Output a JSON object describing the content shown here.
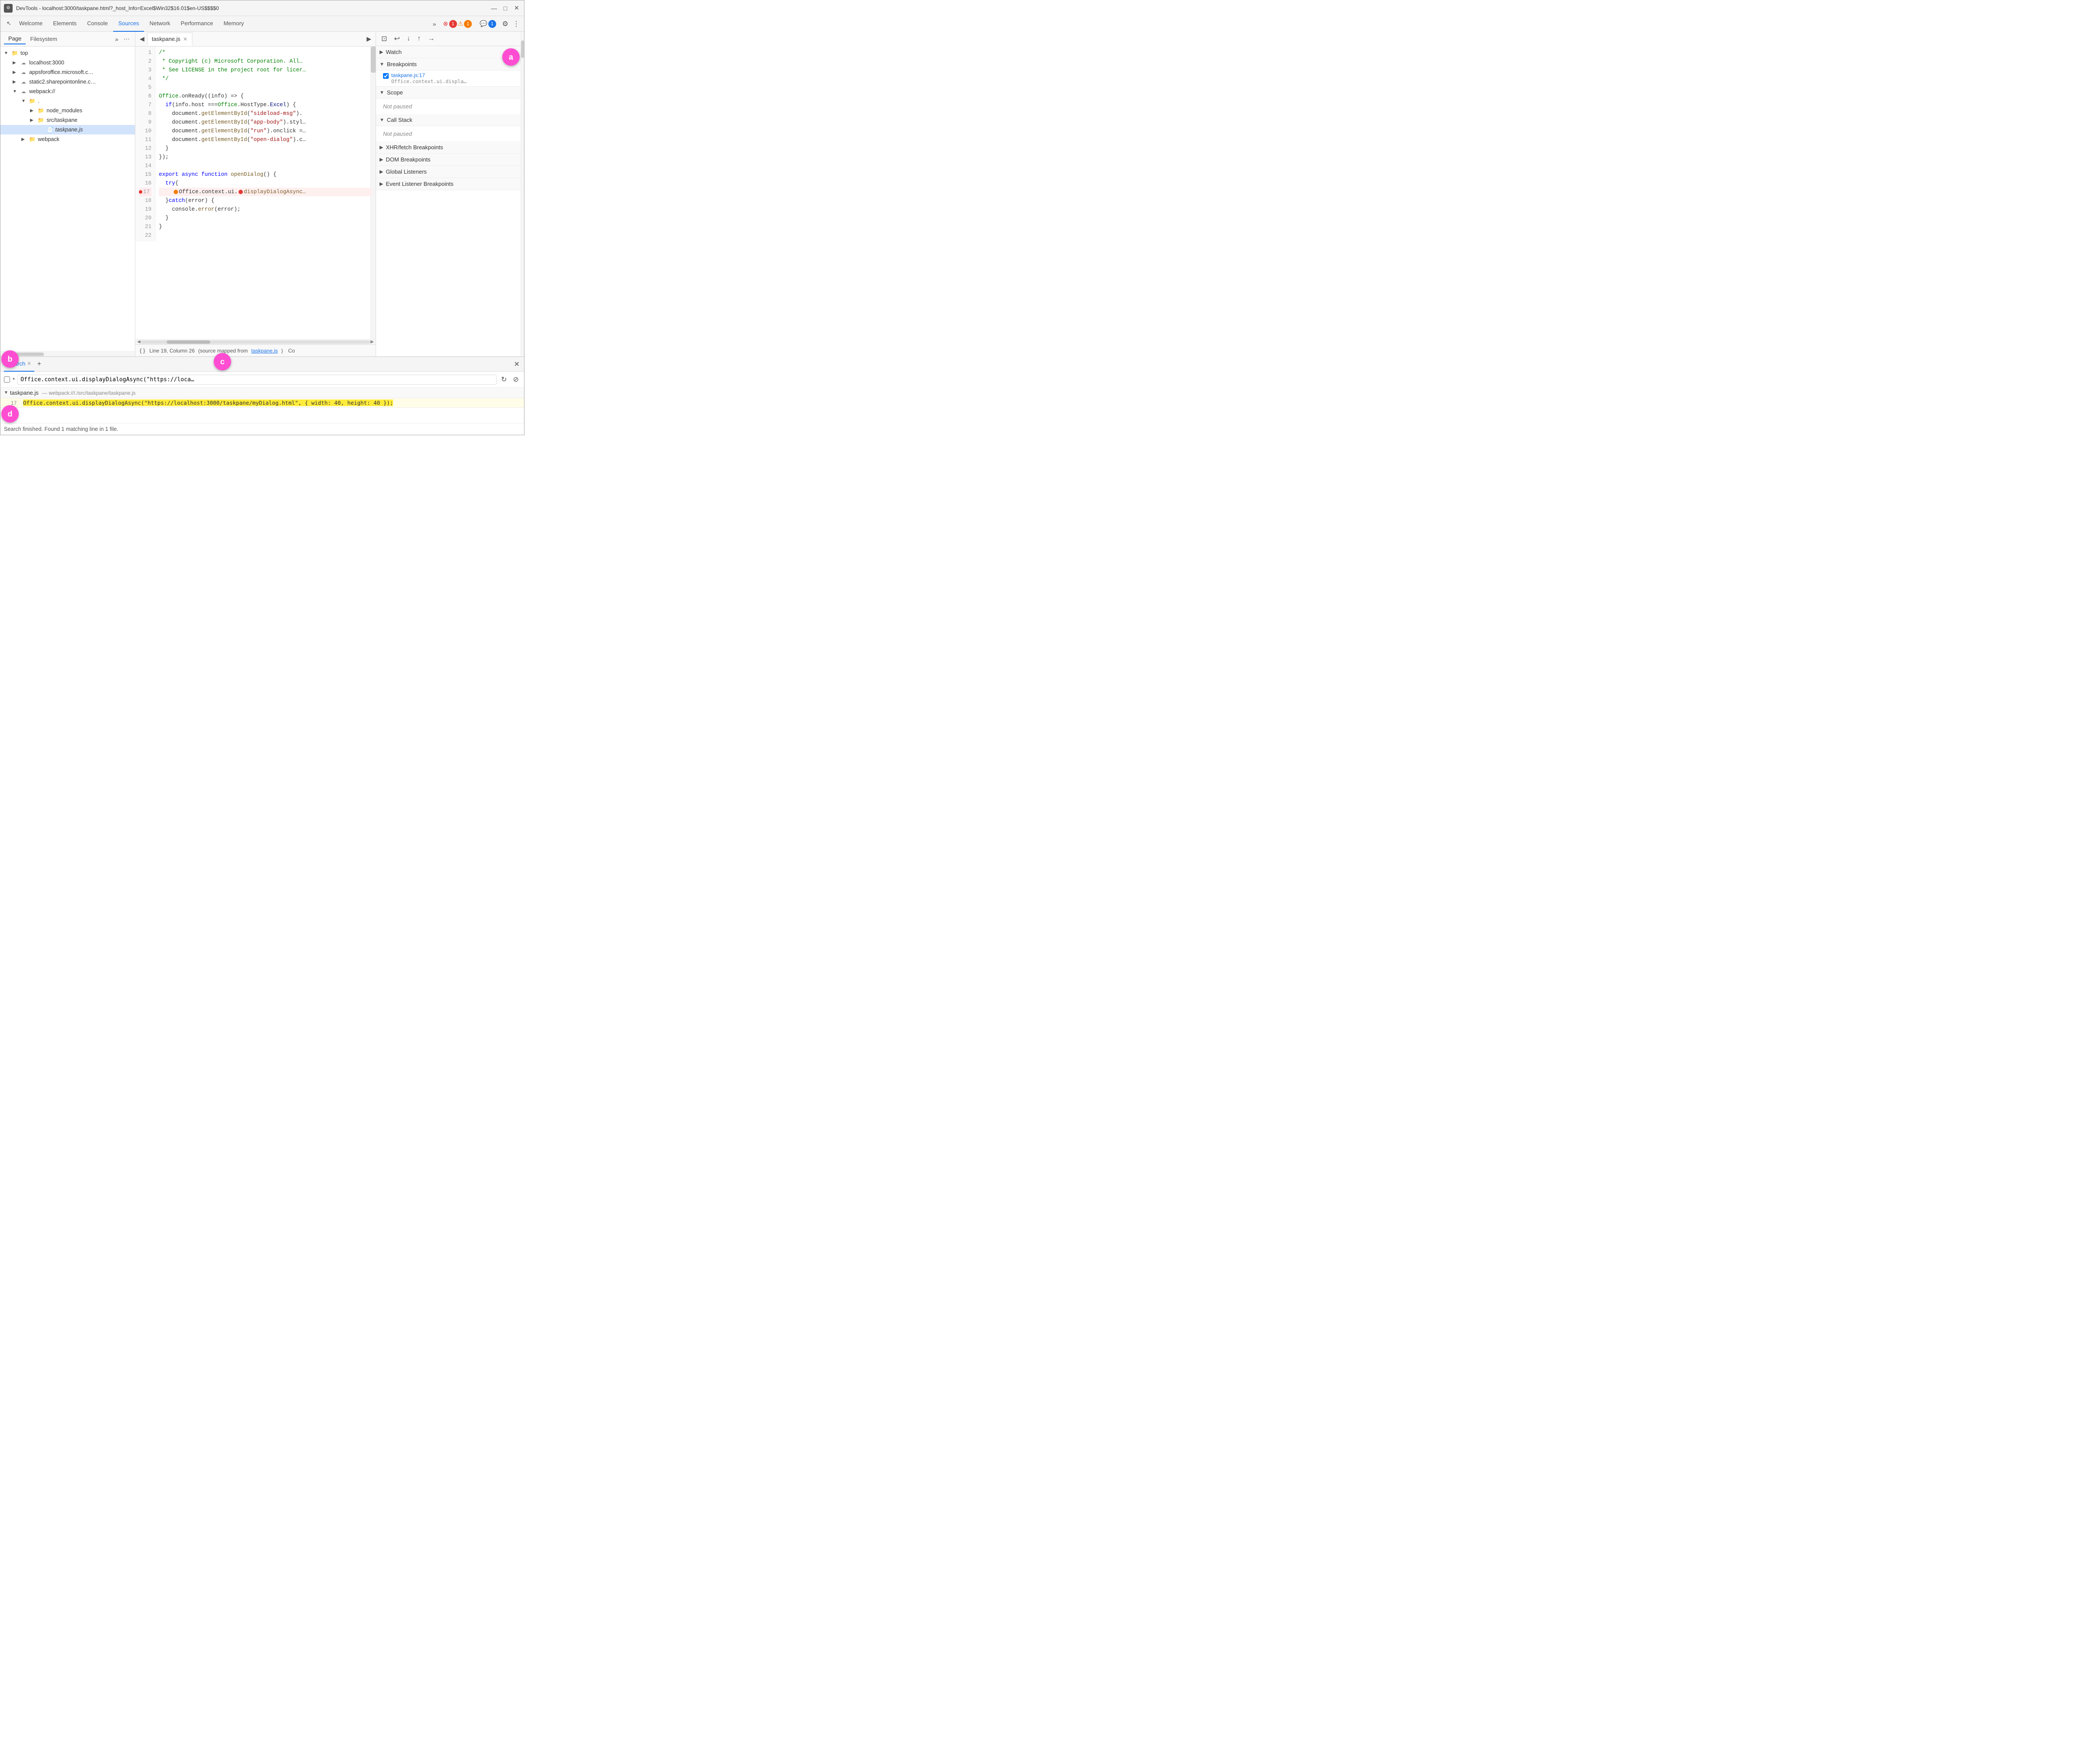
{
  "titlebar": {
    "icon": "⚙",
    "title": "DevTools - localhost:3000/taskpane.html?_host_Info=Excel$Win32$16.01$en-US$$$$0",
    "minimize": "—",
    "maximize": "□",
    "close": "✕"
  },
  "main_tabs": {
    "icon_tab": "↖",
    "tabs": [
      {
        "id": "welcome",
        "label": "Welcome",
        "active": false
      },
      {
        "id": "elements",
        "label": "Elements",
        "active": false
      },
      {
        "id": "console",
        "label": "Console",
        "active": false
      },
      {
        "id": "sources",
        "label": "Sources",
        "active": true
      },
      {
        "id": "network",
        "label": "Network",
        "active": false
      },
      {
        "id": "performance",
        "label": "Performance",
        "active": false
      },
      {
        "id": "memory",
        "label": "Memory",
        "active": false
      }
    ],
    "more_btn": "»",
    "badge_error_count": "1",
    "badge_warn_count": "1",
    "badge_info_count": "1",
    "gear_icon": "⚙",
    "dots_icon": "⋮"
  },
  "left_panel": {
    "tabs": [
      {
        "id": "page",
        "label": "Page",
        "active": true
      },
      {
        "id": "filesystem",
        "label": "Filesystem",
        "active": false
      }
    ],
    "more_btn": "»",
    "dots_btn": "⋯",
    "tree": [
      {
        "id": "top",
        "label": "top",
        "indent": 0,
        "type": "root",
        "expanded": true
      },
      {
        "id": "localhost",
        "label": "localhost:3000",
        "indent": 1,
        "type": "cloud",
        "expanded": false
      },
      {
        "id": "appsforoffice",
        "label": "appsforoffice.microsoft.c…",
        "indent": 1,
        "type": "cloud",
        "expanded": false
      },
      {
        "id": "static2",
        "label": "static2.sharepointonline.c…",
        "indent": 1,
        "type": "cloud",
        "expanded": false
      },
      {
        "id": "webpack",
        "label": "webpack://",
        "indent": 1,
        "type": "cloud-folder",
        "expanded": true
      },
      {
        "id": "dot",
        "label": ".",
        "indent": 2,
        "type": "folder",
        "expanded": true
      },
      {
        "id": "node_modules",
        "label": "node_modules",
        "indent": 3,
        "type": "folder",
        "expanded": false
      },
      {
        "id": "srctaskpane",
        "label": "src/taskpane",
        "indent": 3,
        "type": "folder",
        "expanded": true
      },
      {
        "id": "taskpanejs",
        "label": "taskpane.js",
        "indent": 4,
        "type": "file-active"
      },
      {
        "id": "webpack2",
        "label": "webpack",
        "indent": 2,
        "type": "folder",
        "expanded": false
      }
    ]
  },
  "editor": {
    "tab_label": "taskpane.js",
    "prev_icon": "◀",
    "next_icon": "▶",
    "close_icon": "✕",
    "lines": [
      {
        "num": 1,
        "code": "/*",
        "class": "cm"
      },
      {
        "num": 2,
        "code": " * Copyright (c) Microsoft Corporation. All…",
        "class": "cm"
      },
      {
        "num": 3,
        "code": " * See LICENSE in the project root for licer…",
        "class": "cm"
      },
      {
        "num": 4,
        "code": " */",
        "class": "cm"
      },
      {
        "num": 5,
        "code": ""
      },
      {
        "num": 6,
        "code": "Office.onReady((info) => {",
        "class": "mixed"
      },
      {
        "num": 7,
        "code": "  if (info.host === Office.HostType.Excel) {",
        "class": "mixed"
      },
      {
        "num": 8,
        "code": "    document.getElementById(\"sideload-msg\").",
        "class": "mixed"
      },
      {
        "num": 9,
        "code": "    document.getElementById(\"app-body\").styl…",
        "class": "mixed"
      },
      {
        "num": 10,
        "code": "    document.getElementById(\"run\").onclick =…",
        "class": "mixed"
      },
      {
        "num": 11,
        "code": "    document.getElementById(\"open-dialog\").c…",
        "class": "mixed"
      },
      {
        "num": 12,
        "code": "  }",
        "class": "punc"
      },
      {
        "num": 13,
        "code": "});",
        "class": "punc"
      },
      {
        "num": 14,
        "code": ""
      },
      {
        "num": 15,
        "code": "export async function openDialog() {",
        "class": "mixed"
      },
      {
        "num": 16,
        "code": "  try {",
        "class": "mixed"
      },
      {
        "num": 17,
        "code": "    Office.context.ui.displayDialogAsync…",
        "class": "mixed",
        "breakpoint": true
      },
      {
        "num": 18,
        "code": "  } catch (error) {",
        "class": "mixed"
      },
      {
        "num": 19,
        "code": "    console.error(error);",
        "class": "mixed"
      },
      {
        "num": 20,
        "code": "  }",
        "class": "punc"
      },
      {
        "num": 21,
        "code": "}",
        "class": "punc"
      },
      {
        "num": 22,
        "code": ""
      }
    ],
    "status_bar": {
      "brace_icon": "{ }",
      "position": "Line 19, Column 26",
      "source_mapped": "(source mapped from",
      "source_file": "taskpane.js",
      "paren_close": ")",
      "co_label": "Co"
    }
  },
  "right_panel": {
    "toolbar_buttons": [
      "⊡",
      "↩",
      "↓",
      "↑",
      "→"
    ],
    "sections": [
      {
        "id": "watch",
        "title": "Watch",
        "expanded": false
      },
      {
        "id": "breakpoints",
        "title": "Breakpoints",
        "expanded": true,
        "items": [
          {
            "checked": true,
            "file": "taskpane.js:17",
            "code": "Office.context.ui.displa…"
          }
        ]
      },
      {
        "id": "scope",
        "title": "Scope",
        "expanded": true,
        "not_paused": "Not paused"
      },
      {
        "id": "call_stack",
        "title": "Call Stack",
        "expanded": true,
        "not_paused": "Not paused"
      },
      {
        "id": "xhr_fetch",
        "title": "XHR/fetch Breakpoints",
        "expanded": true
      },
      {
        "id": "dom_breakpoints",
        "title": "DOM Breakpoints",
        "expanded": true
      },
      {
        "id": "global_listeners",
        "title": "Global Listeners",
        "expanded": true
      },
      {
        "id": "event_listeners",
        "title": "Event Listener Breakpoints",
        "expanded": true
      }
    ]
  },
  "bottom_panel": {
    "tabs": [
      {
        "id": "search",
        "label": "Search",
        "active": true
      }
    ],
    "add_tab": "+",
    "close_btn": "✕",
    "search": {
      "checkbox_label": "*",
      "input_value": "Office.context.ui.displayDialogAsync(\"https://loca…",
      "refresh_icon": "↻",
      "clear_icon": "⊘",
      "result_file": "taskpane.js",
      "result_path": "— webpack:///./src/taskpane/taskpane.js",
      "result_linenum": "17",
      "result_code": "Office.context.ui.displayDialogAsync(\"https://localhost:3000/taskpane/myDialog.html\", { width: 40, height: 40 });",
      "status": "Search finished. Found 1 matching line in 1 file."
    }
  },
  "labels": {
    "a": "a",
    "b": "b",
    "c": "c",
    "d": "d"
  }
}
